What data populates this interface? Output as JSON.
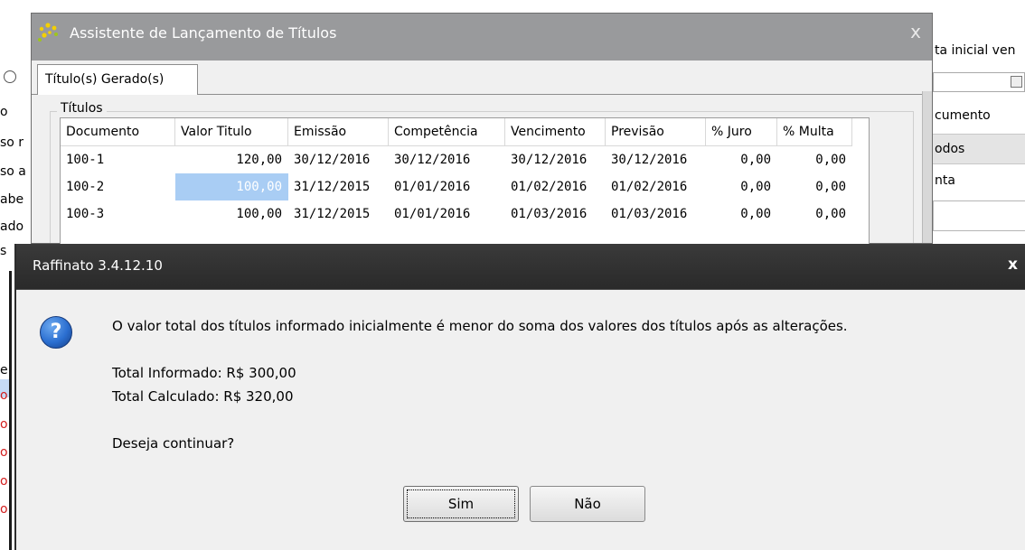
{
  "background_left": {
    "lines": [
      "o",
      "so r",
      "so a",
      "abe",
      "ado",
      "s",
      "e",
      "o",
      "o",
      "o",
      "o",
      "o"
    ]
  },
  "background_right": {
    "label_top": "ta inicial ven",
    "label_documento": "cumento",
    "label_todos": "odos",
    "label_nta": "nta"
  },
  "wizard": {
    "title": "Assistente de Lançamento de Títulos",
    "close_symbol": "x",
    "tab_label": "Título(s) Gerado(s)",
    "group_label": "Títulos",
    "columns": [
      "Documento",
      "Valor Titulo",
      "Emissão",
      "Competência",
      "Vencimento",
      "Previsão",
      "% Juro",
      "% Multa"
    ],
    "rows": [
      [
        "100-1",
        "120,00",
        "30/12/2016",
        "30/12/2016",
        "30/12/2016",
        "30/12/2016",
        "0,00",
        "0,00"
      ],
      [
        "100-2",
        "100,00",
        "31/12/2015",
        "01/01/2016",
        "01/02/2016",
        "01/02/2016",
        "0,00",
        "0,00"
      ],
      [
        "100-3",
        "100,00",
        "31/12/2015",
        "01/01/2016",
        "01/03/2016",
        "01/03/2016",
        "0,00",
        "0,00"
      ]
    ]
  },
  "dialog": {
    "title": "Raffinato 3.4.12.10",
    "close_symbol": "x",
    "message": "O valor total dos títulos informado inicialmente é menor do soma dos valores dos títulos após as alterações.",
    "total_informado": "Total Informado: R$ 300,00",
    "total_calculado": "Total Calculado: R$ 320,00",
    "question": "Deseja continuar?",
    "yes_label": "Sim",
    "no_label": "Não",
    "icon": "question-icon"
  },
  "colors": {
    "wizard_titlebar": "#999a9c",
    "dialog_titlebar": "#2d2d2d",
    "selection": "#a9cdf4"
  }
}
